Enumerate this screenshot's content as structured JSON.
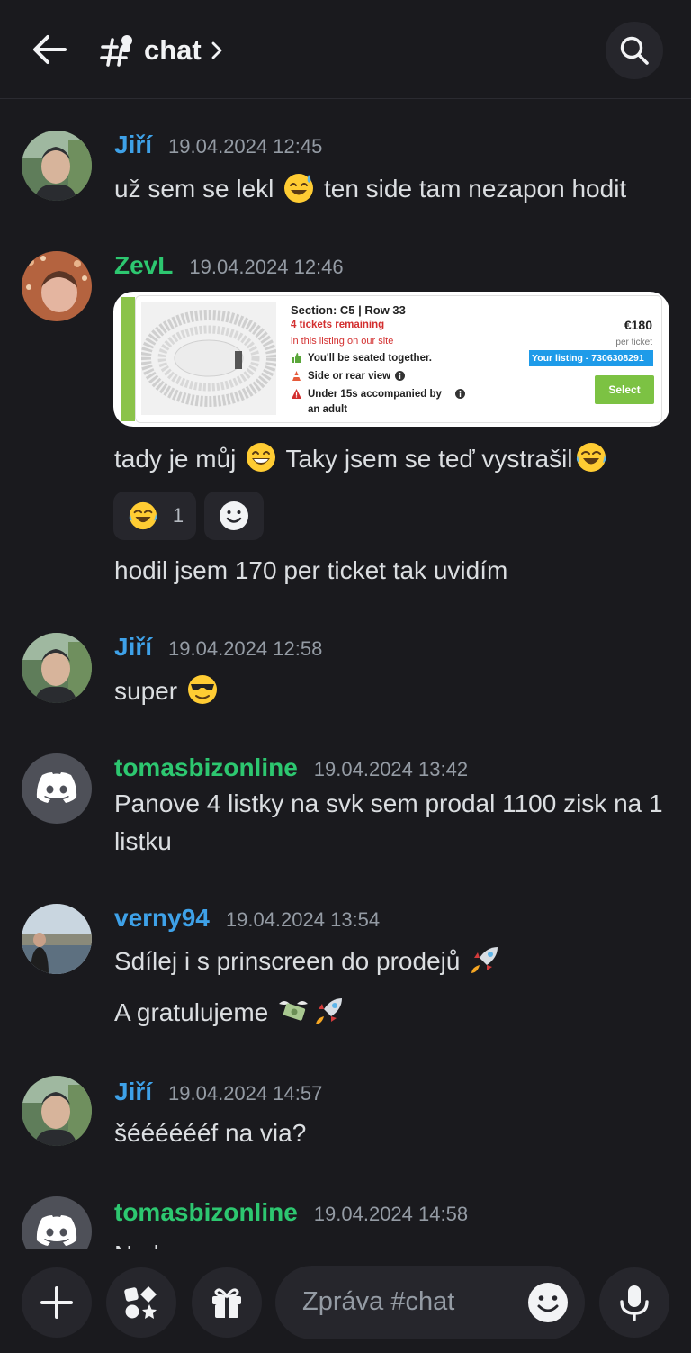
{
  "header": {
    "channel_name": "chat",
    "icons": {
      "back": "arrow-left-icon",
      "channel": "hash-thread-icon",
      "chevron": "chevron-right-icon",
      "search": "search-icon"
    }
  },
  "colors": {
    "blue_user": "#3ea1e8",
    "green_user": "#2dc770",
    "background": "#1a1a1e",
    "surface": "#26262c"
  },
  "messages": [
    {
      "username": "Jiří",
      "username_color": "#3ea1e8",
      "timestamp": "19.04.2024 12:45",
      "lines": [
        {
          "before": "už sem se lekl",
          "emoji": "sweat-smile-emoji",
          "after": " ten side tam nezapon hodit"
        }
      ]
    },
    {
      "username": "ZevL",
      "username_color": "#2dc770",
      "timestamp": "19.04.2024 12:46",
      "attachment": {
        "section": "Section: C5 | Row 33",
        "remaining": "4 tickets remaining",
        "listing_note": "in this listing on our site",
        "seated": "You'll be seated together.",
        "side_view": "Side or rear view",
        "under15": "Under 15s accompanied by",
        "adult": "an adult",
        "price": "€180",
        "per_ticket": "per ticket",
        "your_listing": "Your listing - 7306308291",
        "select": "Select"
      },
      "line1": "tady je můj",
      "line1_mid": " Taky jsem se teď vystrašil",
      "reactions": [
        {
          "emoji": "joy-emoji",
          "count": "1"
        },
        {
          "icon": "add-reaction-icon"
        }
      ],
      "line2": "hodil jsem 170 per ticket tak uvidím"
    },
    {
      "username": "Jiří",
      "username_color": "#3ea1e8",
      "timestamp": "19.04.2024 12:58",
      "text": "super"
    },
    {
      "username": "tomasbizonline",
      "username_color": "#2dc770",
      "timestamp": "19.04.2024 13:42",
      "text": "Panove 4 listky na svk sem prodal 1100 zisk na 1 listku"
    },
    {
      "username": "verny94",
      "username_color": "#3ea1e8",
      "timestamp": "19.04.2024 13:54",
      "line1": "Sdílej i s prinscreen do prodejů",
      "line2": "A gratulujeme"
    },
    {
      "username": "Jiří",
      "username_color": "#3ea1e8",
      "timestamp": "19.04.2024 14:57",
      "text": "šééééééf na via?"
    },
    {
      "username": "tomasbizonline",
      "username_color": "#2dc770",
      "timestamp": "19.04.2024 14:58",
      "text": "Ne lo"
    }
  ],
  "composer": {
    "placeholder": "Zpráva #chat",
    "icons": {
      "add": "plus-icon",
      "apps": "apps-icon",
      "gift": "gift-icon",
      "emoji": "smiley-icon",
      "mic": "microphone-icon"
    }
  }
}
